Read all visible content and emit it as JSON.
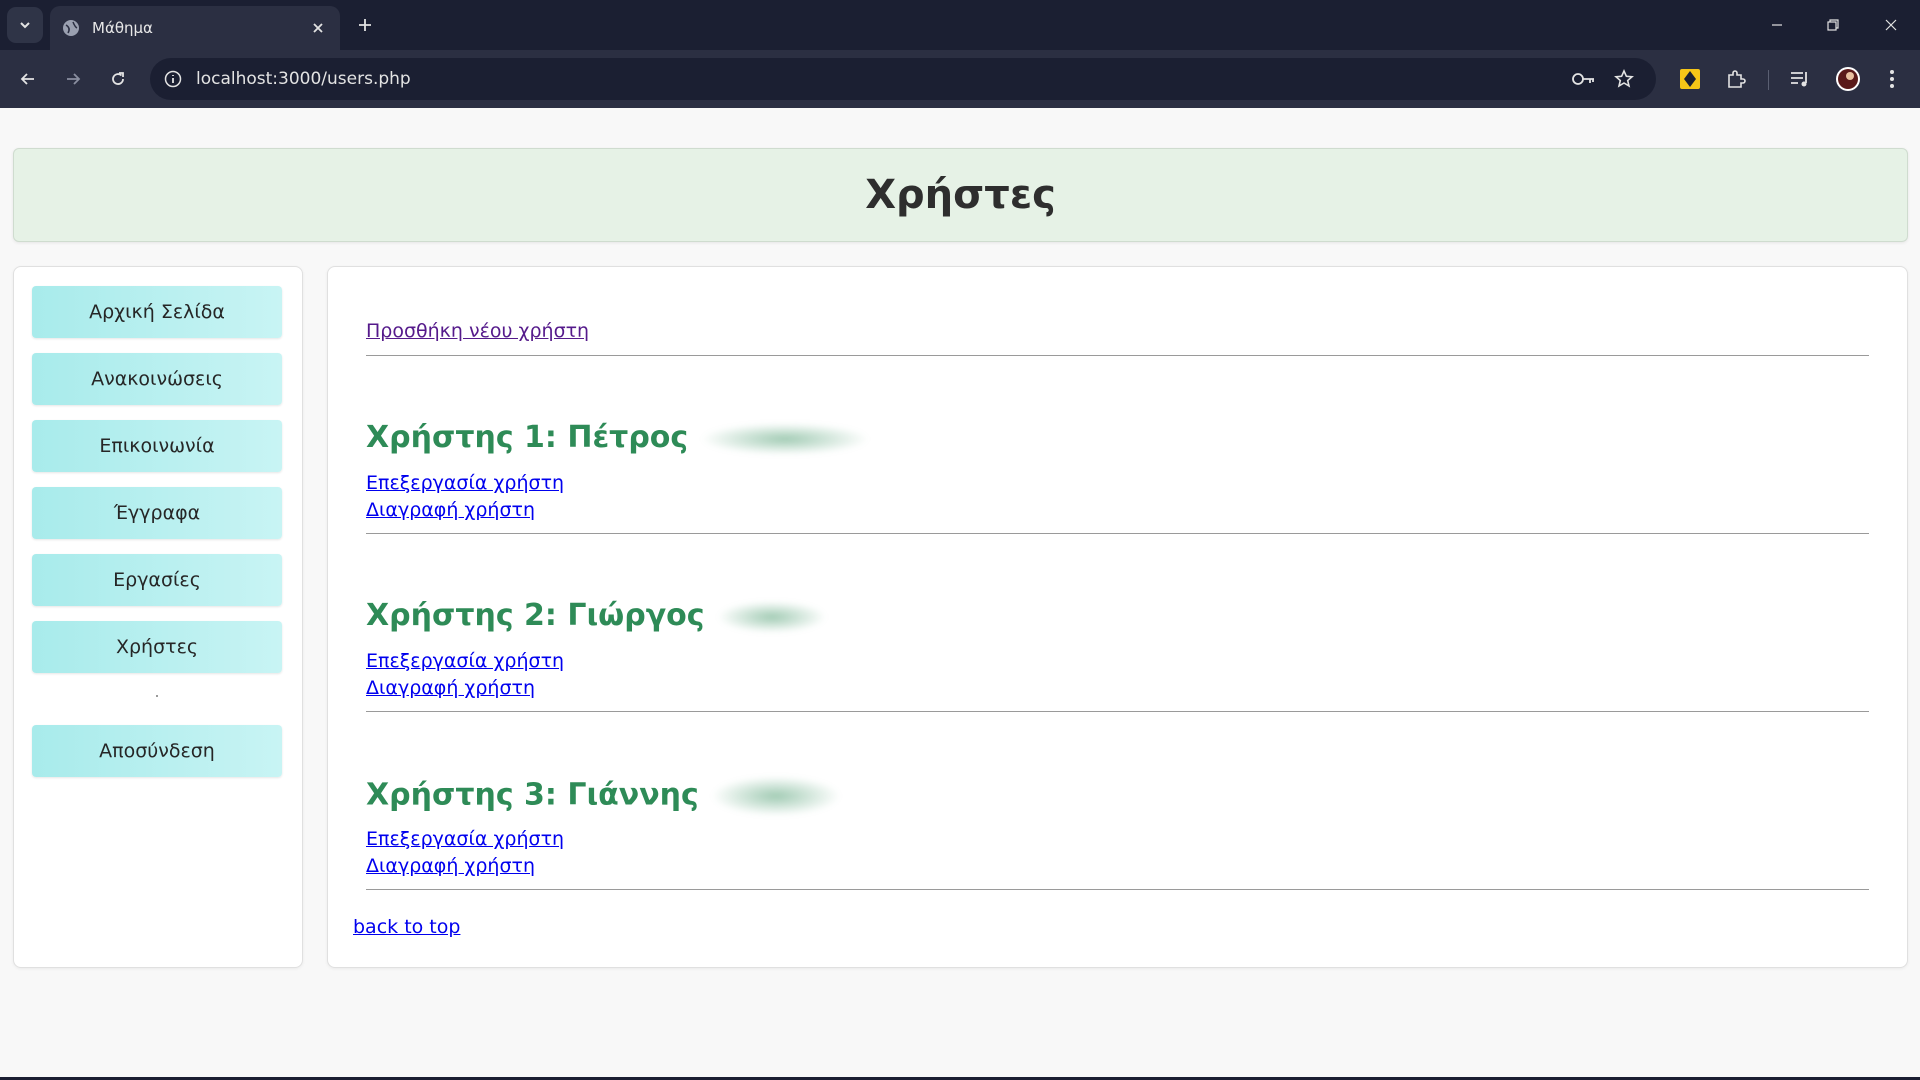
{
  "browser": {
    "tab_title": "Μάθημα",
    "url": "localhost:3000/users.php"
  },
  "page": {
    "title": "Χρήστες"
  },
  "sidebar": {
    "items": [
      {
        "label": "Αρχική Σελίδα"
      },
      {
        "label": "Ανακοινώσεις"
      },
      {
        "label": "Επικοινωνία"
      },
      {
        "label": "Έγγραφα"
      },
      {
        "label": "Εργασίες"
      },
      {
        "label": "Χρήστες"
      },
      {
        "label": "Αποσύνδεση"
      }
    ]
  },
  "main": {
    "add_user_link": "Προσθήκη νέου χρήστη",
    "users": [
      {
        "title": "Χρήστης 1: Πέτρος",
        "edit_label": "Επεξεργασία χρήστη",
        "delete_label": "Διαγραφή χρήστη"
      },
      {
        "title": "Χρήστης 2: Γιώργος",
        "edit_label": "Επεξεργασία χρήστη",
        "delete_label": "Διαγραφή χρήστη"
      },
      {
        "title": "Χρήστης 3: Γιάννης",
        "edit_label": "Επεξεργασία χρήστη",
        "delete_label": "Διαγραφή χρήστη"
      }
    ],
    "back_to_top": "back to top"
  },
  "colors": {
    "header_bg": "#e6f2e6",
    "menu_bg": "#a8ebeb",
    "user_title": "#2e8b57",
    "link": "#0000ee",
    "visited_link": "#551a8b"
  },
  "icons": [
    "chevron-down-icon",
    "globe-icon",
    "close-icon",
    "plus-icon",
    "minimize-icon",
    "restore-icon",
    "back-icon",
    "forward-icon",
    "reload-icon",
    "info-icon",
    "key-icon",
    "star-icon",
    "extension-icon",
    "puzzle-icon",
    "media-icon",
    "avatar",
    "menu-icon"
  ]
}
